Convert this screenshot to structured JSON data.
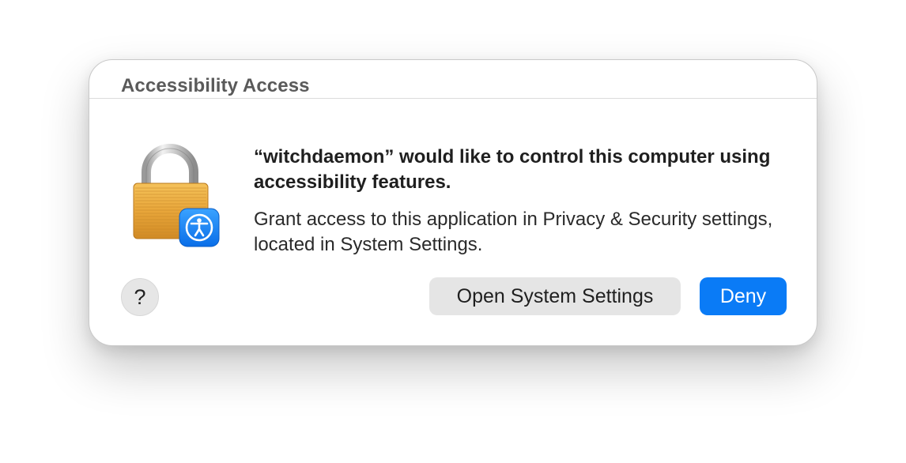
{
  "dialog": {
    "title": "Accessibility Access",
    "headline": "“witchdaemon” would like to control this computer using accessibility features.",
    "body": "Grant access to this application in Privacy & Security settings, located in System Settings.",
    "icon": "lock-icon",
    "badge_icon": "accessibility-icon",
    "help_label": "?",
    "open_settings_label": "Open System Settings",
    "deny_label": "Deny",
    "accent_color": "#0a7bf6"
  }
}
